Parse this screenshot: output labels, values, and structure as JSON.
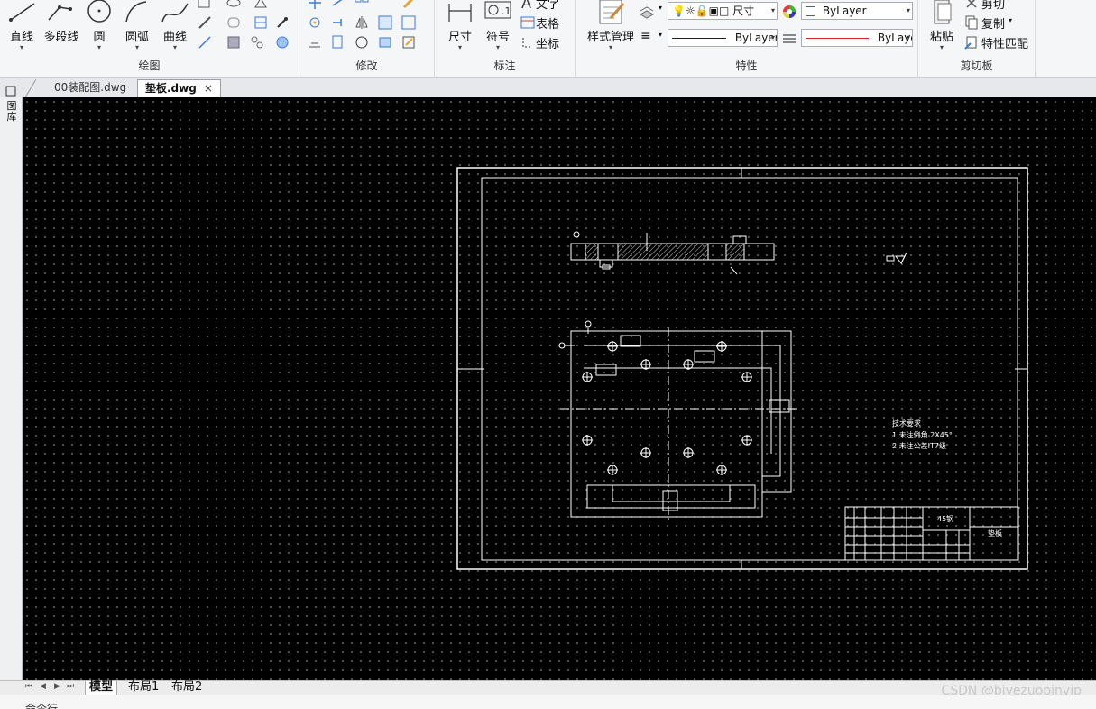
{
  "ribbon": {
    "draw_panel": {
      "title": "绘图",
      "buttons": [
        {
          "label": "直线",
          "icon": "line-icon"
        },
        {
          "label": "多段线",
          "icon": "polyline-icon"
        },
        {
          "label": "圆",
          "icon": "circle-icon"
        },
        {
          "label": "圆弧",
          "icon": "arc-icon"
        },
        {
          "label": "曲线",
          "icon": "spline-icon"
        }
      ]
    },
    "modify_panel": {
      "title": "修改"
    },
    "annotation_panel": {
      "title": "标注",
      "buttons": [
        {
          "label": "尺寸",
          "icon": "dimension-icon"
        },
        {
          "label": "符号",
          "icon": "symbol-icon"
        }
      ],
      "small_items": [
        {
          "label": "文字",
          "icon": "text-icon"
        },
        {
          "label": "表格",
          "icon": "table-icon"
        },
        {
          "label": "坐标",
          "icon": "coordinate-icon"
        }
      ]
    },
    "properties_panel": {
      "title": "特性",
      "style_manager_label": "样式管理",
      "layer_value": "尺寸",
      "color_value": "ByLayer",
      "linetype_value": "ByLayer",
      "lineweight_value": "ByLayer"
    },
    "clipboard_panel": {
      "title": "剪切板",
      "paste_label": "粘贴",
      "cut_label": "剪切",
      "copy_label": "复制",
      "match_label": "特性匹配"
    }
  },
  "file_tabs": [
    {
      "label": "00装配图.dwg",
      "active": false
    },
    {
      "label": "垫板.dwg",
      "active": true,
      "close": "×"
    }
  ],
  "left_strip_label": "图库",
  "drawing": {
    "notes_title": "技术要求",
    "note_1": "1.未注倒角 2X45°",
    "note_2": "2.未注公差IT7级",
    "title_block_material": "45钢",
    "title_block_name": "垫板"
  },
  "layout_tabs": [
    {
      "label": "模型",
      "active": true
    },
    {
      "label": "布局1",
      "active": false
    },
    {
      "label": "布局2",
      "active": false
    }
  ],
  "nav_buttons": [
    "⏮",
    "◀",
    "▶",
    "⏭"
  ],
  "command_label": "命令行",
  "watermark": "CSDN @biyezuopinvip"
}
